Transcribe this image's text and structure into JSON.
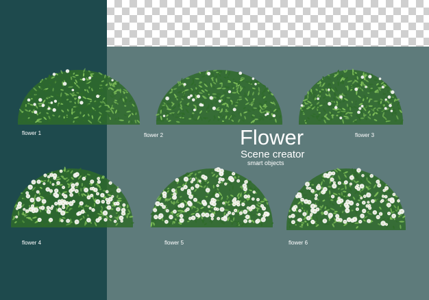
{
  "title": "Flower",
  "subtitle": "Scene creator",
  "tagline": "smart objects",
  "labels": [
    "flower 1",
    "flower 2",
    "flower 3",
    "flower 4",
    "flower 5",
    "flower 6"
  ],
  "colors": {
    "left_panel": "#1e4a4d",
    "background": "#5e7b7b",
    "leaf_dark": "#2f6b2a",
    "leaf_light": "#7fbf5a",
    "blossom": "#f4f6f1"
  }
}
